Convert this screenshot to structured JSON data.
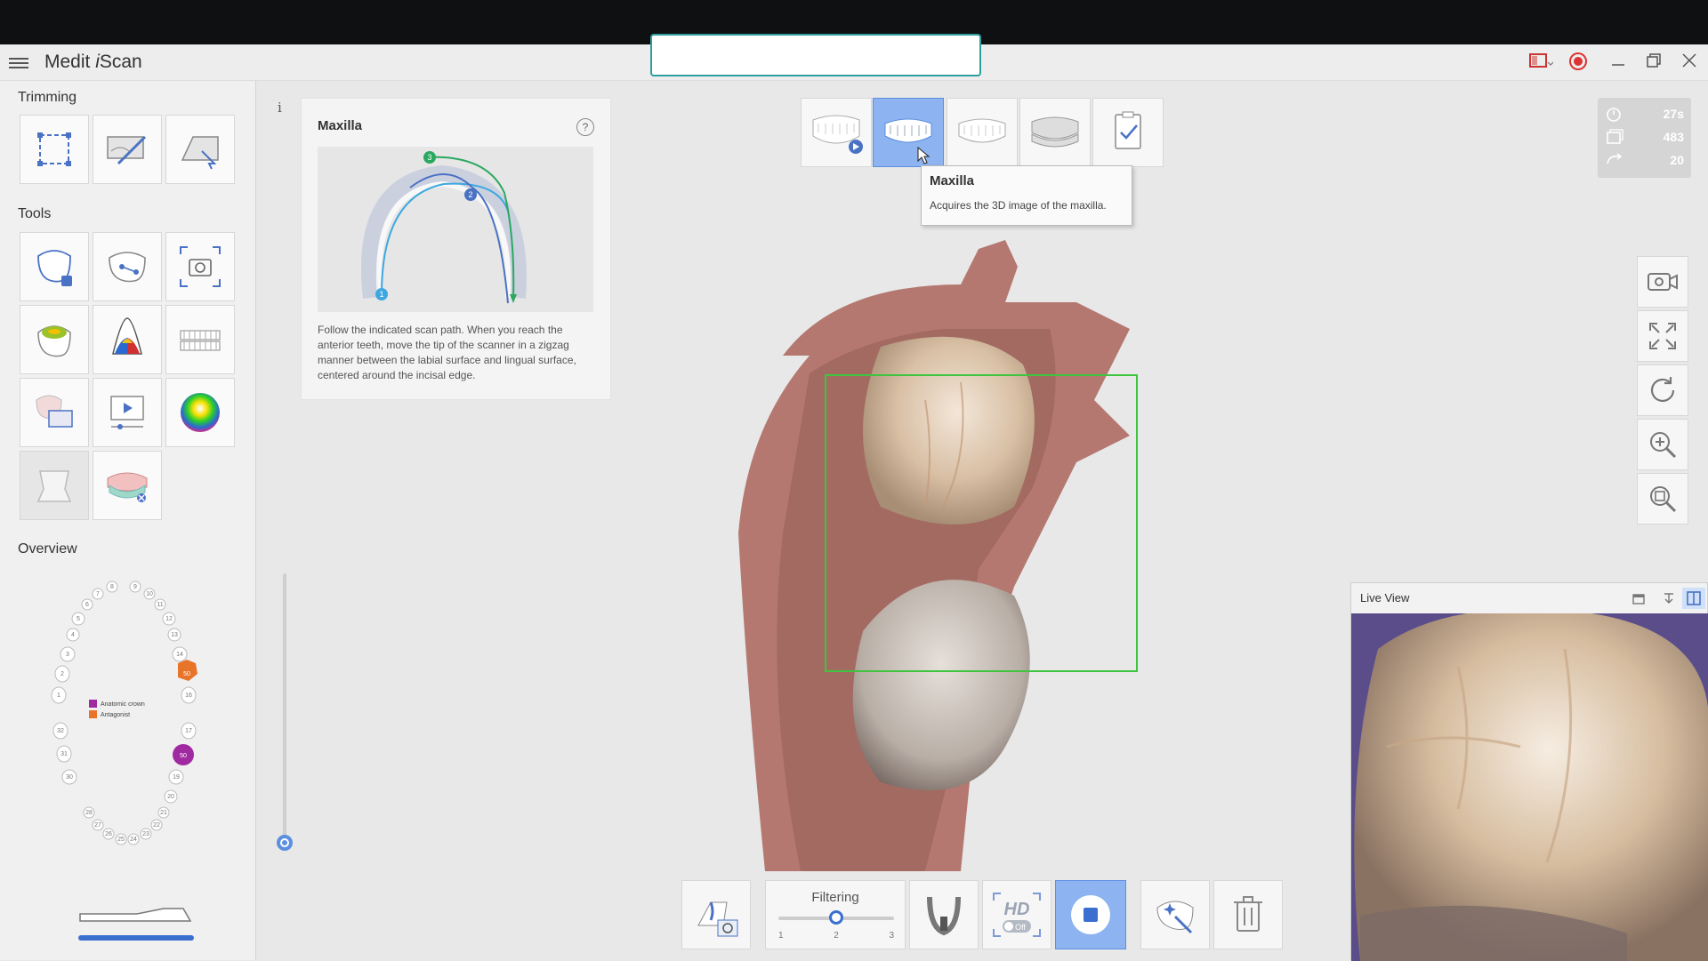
{
  "app": {
    "title_prefix": "Medit ",
    "title_italic": "i",
    "title_suffix": "Scan"
  },
  "sidebar": {
    "trimming_title": "Trimming",
    "tools_title": "Tools",
    "overview_title": "Overview",
    "legend": [
      "Anatomic crown",
      "Antagonist"
    ],
    "tooth_numbers": [
      "1",
      "2",
      "3",
      "4",
      "5",
      "6",
      "7",
      "8",
      "9",
      "10",
      "11",
      "12",
      "13",
      "14",
      "16",
      "17",
      "19",
      "20",
      "21",
      "22",
      "23",
      "24",
      "25",
      "26",
      "27",
      "28",
      "30",
      "31",
      "32"
    ],
    "tooth_markers": [
      "50",
      "50"
    ],
    "colors": {
      "antagonist": "#e8742a",
      "crown": "#a02aa0"
    }
  },
  "info_panel": {
    "title": "Maxilla",
    "help": "?",
    "path_labels": [
      "1",
      "2",
      "3"
    ],
    "description": "Follow the indicated scan path. When you reach the anterior teeth, move the tip of the scanner in a zigzag manner between the labial surface and lingual surface, centered around the incisal edge."
  },
  "stages": {
    "active_index": 1,
    "tooltip": {
      "title": "Maxilla",
      "desc": "Acquires the 3D image of the maxilla."
    }
  },
  "stats": {
    "time": "27s",
    "frames": "483",
    "rotation": "20"
  },
  "live_view": {
    "title": "Live View"
  },
  "bottom": {
    "filtering_label": "Filtering",
    "filter_ticks": [
      "1",
      "2",
      "3"
    ],
    "filter_value": 2,
    "hd_label": "HD",
    "hd_state": "Off"
  },
  "accent": "#2e9e9e"
}
